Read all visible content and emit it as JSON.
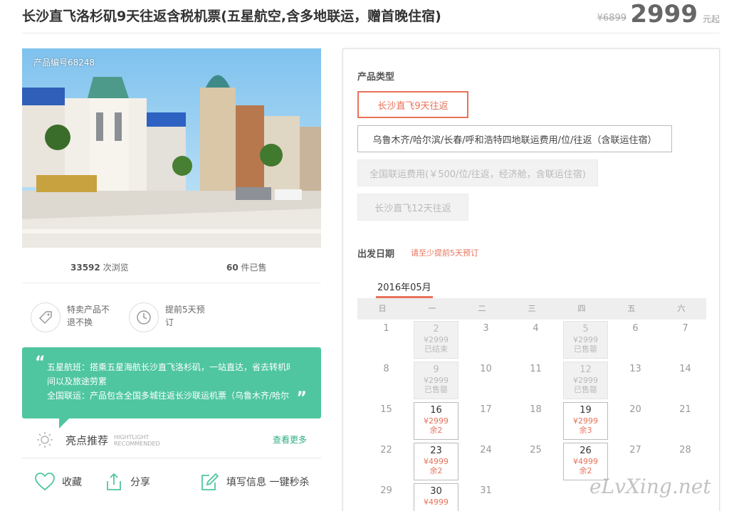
{
  "product": {
    "title": "长沙直飞洛杉矶9天往返含税机票(五星航空,含多地联运，赠首晚住宿)",
    "old_price": "¥6899",
    "price": "2999",
    "price_unit": "元起",
    "code": "产品编号68248"
  },
  "stats": {
    "views_num": "33592",
    "views_label": "次浏览",
    "sold_num": "60",
    "sold_label": "件已售"
  },
  "features": [
    {
      "icon": "tag-icon",
      "line1": "特卖产品不",
      "line2": "退不换"
    },
    {
      "icon": "clock-icon",
      "line1": "提前5天预",
      "line2": "订"
    }
  ],
  "highlight": {
    "line1_label": "五星航班：",
    "line1": "搭乘五星海航长沙直飞洛杉矶，一站直达，省去转机时",
    "line2": "间以及旅途劳累",
    "line3_label": "全国联运：",
    "line3": "产品包含全国多城往返长沙联运机票（乌鲁木齐/哈尔"
  },
  "recommend": {
    "label": "亮点推荐",
    "en1": "HIGHTLIGHT",
    "en2": "RECOMMENDED",
    "more": "查看更多"
  },
  "actions": {
    "favorite": "收藏",
    "share": "分享",
    "fill_info": "填写信息 一键秒杀"
  },
  "booking": {
    "type_label": "产品类型",
    "options": [
      {
        "label": "长沙直飞9天往返",
        "state": "selected"
      },
      {
        "label": "乌鲁木齐/哈尔滨/长春/呼和浩特四地联运费用/位/往返（含联运住宿）",
        "state": "normal"
      },
      {
        "label": "全国联运费用(￥500/位/往返，经济舱，含联运住宿)",
        "state": "disabled"
      },
      {
        "label": "长沙直飞12天往返",
        "state": "disabled"
      }
    ],
    "date_label": "出发日期",
    "date_note": "请至少提前5天预订",
    "month": "2016年05月",
    "weekdays": [
      "日",
      "一",
      "二",
      "三",
      "四",
      "五",
      "六"
    ],
    "weeks": [
      [
        {
          "d": "1"
        },
        {
          "d": "2",
          "p": "¥2999",
          "s": "已结束",
          "st": "sold"
        },
        {
          "d": "3"
        },
        {
          "d": "4"
        },
        {
          "d": "5",
          "p": "¥2999",
          "s": "已售罄",
          "st": "sold"
        },
        {
          "d": "6"
        },
        {
          "d": "7"
        }
      ],
      [
        {
          "d": "8"
        },
        {
          "d": "9",
          "p": "¥2999",
          "s": "已售罄",
          "st": "sold"
        },
        {
          "d": "10"
        },
        {
          "d": "11"
        },
        {
          "d": "12",
          "p": "¥2999",
          "s": "已售罄",
          "st": "sold"
        },
        {
          "d": "13"
        },
        {
          "d": "14"
        }
      ],
      [
        {
          "d": "15"
        },
        {
          "d": "16",
          "p": "¥2999",
          "s": "余2",
          "st": "avail"
        },
        {
          "d": "17"
        },
        {
          "d": "18"
        },
        {
          "d": "19",
          "p": "¥2999",
          "s": "余3",
          "st": "avail"
        },
        {
          "d": "20"
        },
        {
          "d": "21"
        }
      ],
      [
        {
          "d": "22"
        },
        {
          "d": "23",
          "p": "¥4999",
          "s": "余2",
          "st": "avail"
        },
        {
          "d": "24"
        },
        {
          "d": "25"
        },
        {
          "d": "26",
          "p": "¥4999",
          "s": "余2",
          "st": "avail"
        },
        {
          "d": "27"
        },
        {
          "d": "28"
        }
      ],
      [
        {
          "d": "29"
        },
        {
          "d": "30",
          "p": "¥4999",
          "s": "",
          "st": "avail"
        },
        {
          "d": "31"
        },
        {
          "d": ""
        },
        {
          "d": ""
        },
        {
          "d": ""
        },
        {
          "d": ""
        }
      ]
    ]
  },
  "watermark": "eLvXing.net",
  "colors": {
    "accent": "#e8725a",
    "green": "#4fc6a0"
  }
}
